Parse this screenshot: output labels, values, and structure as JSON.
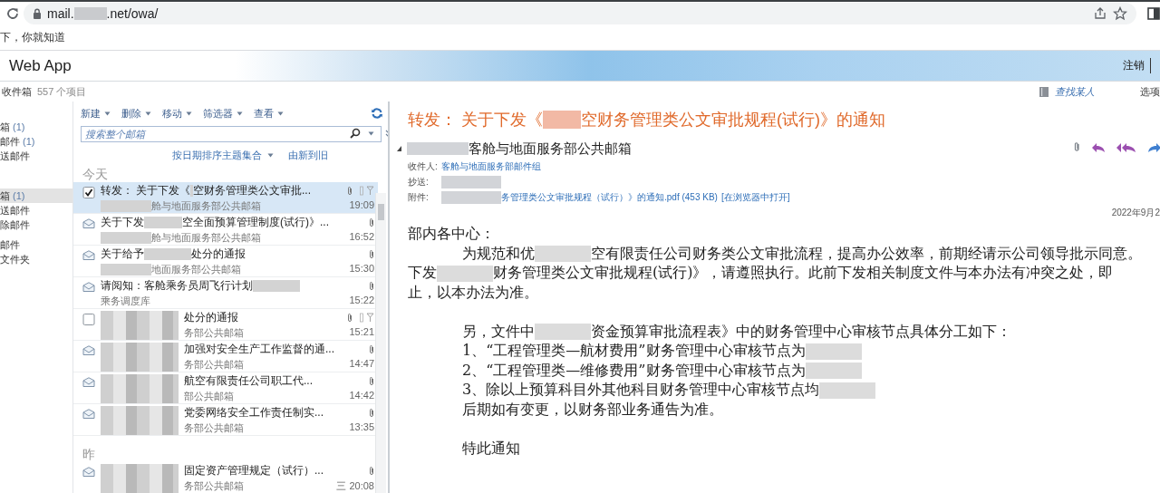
{
  "browser": {
    "url": [
      {
        "kind": "text",
        "text": "mail."
      },
      {
        "kind": "redacted"
      },
      {
        "kind": "text",
        "text": ".net/owa/"
      }
    ]
  },
  "bookmark_bar": {
    "item": "下，你就知道"
  },
  "app": {
    "title": "Web App",
    "sign_out": "注销"
  },
  "folder_header": {
    "name": "收件箱",
    "count": "557 个项目"
  },
  "header_links": {
    "find_someone": "查找某人",
    "options": "选项"
  },
  "nav": {
    "items": [
      {
        "label": "箱",
        "count": "(1)",
        "selected": false
      },
      {
        "label": "邮件",
        "count": "(1)",
        "selected": false
      },
      {
        "label": "送邮件",
        "selected": false
      },
      {
        "label": "箱",
        "count": "(1)",
        "selected": true
      },
      {
        "label": "送邮件",
        "selected": false
      },
      {
        "label": "除邮件",
        "selected": false
      },
      {
        "label": "邮件",
        "selected": false
      },
      {
        "label": "文件夹",
        "selected": false
      }
    ]
  },
  "toolbar": {
    "menus": [
      "新建",
      "删除",
      "移动",
      "筛选器",
      "查看"
    ]
  },
  "search": {
    "placeholder": "搜索整个邮箱"
  },
  "sort": {
    "by": "按日期排序主题集合",
    "order": "由新到旧"
  },
  "groups": [
    {
      "label": "今天",
      "messages": [
        {
          "kind": "checkbox",
          "selected": true,
          "subject": [
            {
              "kind": "text",
              "text": "转发： 关于下发《"
            },
            {
              "kind": "redacted"
            },
            {
              "kind": "text",
              "text": "空财务管理类公文审批..."
            }
          ],
          "sender": [
            {
              "kind": "redacted"
            },
            {
              "kind": "text",
              "text": "舱与地面服务部公共邮箱"
            }
          ],
          "time": "19:09",
          "attachment": true,
          "flag": true
        },
        {
          "kind": "envelope",
          "selected": false,
          "subject": [
            {
              "kind": "text",
              "text": "关于下发"
            },
            {
              "kind": "redacted"
            },
            {
              "kind": "text",
              "text": "空全面预算管理制度(试行)》..."
            }
          ],
          "sender": [
            {
              "kind": "redacted"
            },
            {
              "kind": "text",
              "text": "舱与地面服务部公共邮箱"
            }
          ],
          "time": "16:52",
          "attachment": true,
          "flag": false
        },
        {
          "kind": "envelope",
          "selected": false,
          "subject": [
            {
              "kind": "text",
              "text": "关于给予"
            },
            {
              "kind": "redacted"
            },
            {
              "kind": "text",
              "text": "处分的通报"
            }
          ],
          "sender": [
            {
              "kind": "redacted"
            },
            {
              "kind": "text",
              "text": "地面服务部公共邮箱"
            }
          ],
          "time": "15:30",
          "attachment": true,
          "flag": false
        },
        {
          "kind": "envelope",
          "selected": false,
          "subject": [
            {
              "kind": "text",
              "text": "请阅知：客舱乘务员周飞行计划"
            },
            {
              "kind": "redacted"
            }
          ],
          "sender": [
            {
              "kind": "text",
              "text": "乘务调度库"
            }
          ],
          "time": "15:22",
          "attachment": true,
          "flag": false
        },
        {
          "kind": "checkbox",
          "selected": false,
          "subject": [
            {
              "kind": "mosaic"
            },
            {
              "kind": "text",
              "text": "处分的通报"
            }
          ],
          "sender": [
            {
              "kind": "text",
              "text": "务部公共邮箱"
            }
          ],
          "time": "15:21",
          "attachment": true,
          "flag": true
        },
        {
          "kind": "envelope",
          "selected": false,
          "subject": [
            {
              "kind": "mosaic"
            },
            {
              "kind": "text",
              "text": "加强对安全生产工作监督的通..."
            }
          ],
          "sender": [
            {
              "kind": "text",
              "text": "务部公共邮箱"
            }
          ],
          "time": "14:47",
          "attachment": true,
          "flag": false
        },
        {
          "kind": "envelope",
          "selected": false,
          "subject": [
            {
              "kind": "mosaic"
            },
            {
              "kind": "text",
              "text": "航空有限责任公司职工代..."
            }
          ],
          "sender": [
            {
              "kind": "text",
              "text": "部公共邮箱"
            }
          ],
          "time": "14:42",
          "attachment": true,
          "flag": false
        },
        {
          "kind": "envelope",
          "selected": false,
          "subject": [
            {
              "kind": "mosaic"
            },
            {
              "kind": "text",
              "text": "党委网络安全工作责任制实..."
            }
          ],
          "sender": [
            {
              "kind": "text",
              "text": "务部公共邮箱"
            }
          ],
          "time": "13:35",
          "attachment": true,
          "flag": false
        }
      ]
    },
    {
      "label": "昨",
      "messages": [
        {
          "kind": "envelope",
          "selected": false,
          "subject": [
            {
              "kind": "mosaic"
            },
            {
              "kind": "text",
              "text": "固定资产管理规定（试行）..."
            }
          ],
          "sender": [
            {
              "kind": "text",
              "text": "务部公共邮箱"
            }
          ],
          "time": "三 20:08",
          "attachment": true,
          "flag": false
        }
      ]
    }
  ],
  "reading": {
    "subject": [
      {
        "kind": "text",
        "text": "转发： 关于下发《"
      },
      {
        "kind": "redacted"
      },
      {
        "kind": "text",
        "text": "空财务管理类公文审批规程(试行)》的通知"
      }
    ],
    "from": [
      {
        "kind": "redacted"
      },
      {
        "kind": "text",
        "text": "客舱与地面服务部公共邮箱"
      }
    ],
    "fields": [
      {
        "label": "收件人:",
        "value": [
          {
            "kind": "link",
            "text": "客舱与地面服务部邮件组"
          }
        ]
      },
      {
        "label": "抄送:",
        "value": [
          {
            "kind": "redacted"
          }
        ]
      },
      {
        "label": "附件:",
        "value": [
          {
            "kind": "redacted"
          },
          {
            "kind": "link",
            "text": "务管理类公文审批规程（试行）》的通知.pdf (453 KB)"
          },
          {
            "kind": "link",
            "text": "[在浏览器中打开]"
          }
        ]
      }
    ],
    "date": "2022年9月2",
    "body": [
      {
        "kind": "salutation",
        "lines": [
          [
            {
              "kind": "text",
              "text": "部内各中心："
            }
          ]
        ]
      },
      {
        "kind": "paragraph",
        "lines": [
          [
            {
              "kind": "text",
              "text": "为规范和优"
            },
            {
              "kind": "redacted"
            },
            {
              "kind": "text",
              "text": "空有限责任公司财务类公文审批流程，提高办公效率，前期经请示公司领导批示同意。"
            }
          ],
          [
            {
              "kind": "text",
              "text": "下发"
            },
            {
              "kind": "redacted"
            },
            {
              "kind": "text",
              "text": "财务管理类公文审批规程(试行)》，请遵照执行。此前下发相关制度文件与本办法有冲突之处，即"
            }
          ],
          [
            {
              "kind": "text",
              "text": "止，以本办法为准。"
            }
          ]
        ]
      },
      {
        "kind": "block",
        "lines": [
          [
            {
              "kind": "text",
              "text": "另，文件中"
            },
            {
              "kind": "redacted"
            },
            {
              "kind": "text",
              "text": "资金预算审批流程表》中的财务管理中心审核节点具体分工如下："
            }
          ],
          [
            {
              "kind": "text",
              "text": "1、“工程管理类—航材费用”财务管理中心审核节点为"
            },
            {
              "kind": "redacted"
            }
          ],
          [
            {
              "kind": "text",
              "text": "2、“工程管理类—维修费用”财务管理中心审核节点为"
            },
            {
              "kind": "redacted"
            }
          ],
          [
            {
              "kind": "text",
              "text": "3、除以上预算科目外其他科目财务管理中心审核节点均"
            },
            {
              "kind": "redacted"
            }
          ],
          [
            {
              "kind": "text",
              "text": "后期如有变更，以财务部业务通告为准。"
            }
          ]
        ]
      },
      {
        "kind": "block",
        "lines": [
          [
            {
              "kind": "text",
              "text": "特此通知"
            }
          ]
        ]
      }
    ]
  }
}
